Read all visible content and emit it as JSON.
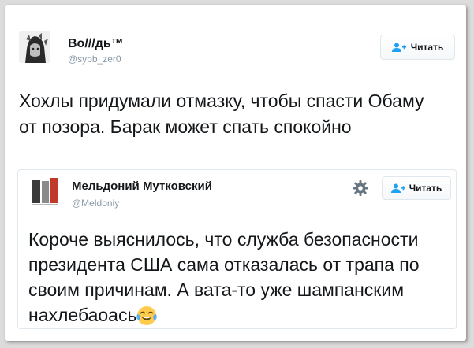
{
  "tweet": {
    "author_name": "Во///дь™",
    "author_handle": "@sybb_zer0",
    "follow_label": "Читать",
    "text": "Хохлы придумали отмазку, чтобы спасти Обаму от позора. Барак может спать спокойно"
  },
  "quoted_tweet": {
    "author_name": "Мельдоний Мутковский",
    "author_handle": "@Meldoniy",
    "follow_label": "Читать",
    "text": "Короче выяснилось, что служба безопасности президента США сама отказалась от трапа по своим причинам. А вата-то уже шампанским нахлебаоась",
    "emoji": "face-with-tears-of-joy"
  },
  "colors": {
    "accent": "#1da1f2",
    "muted": "#8899a6",
    "border": "#e1e8ed"
  }
}
